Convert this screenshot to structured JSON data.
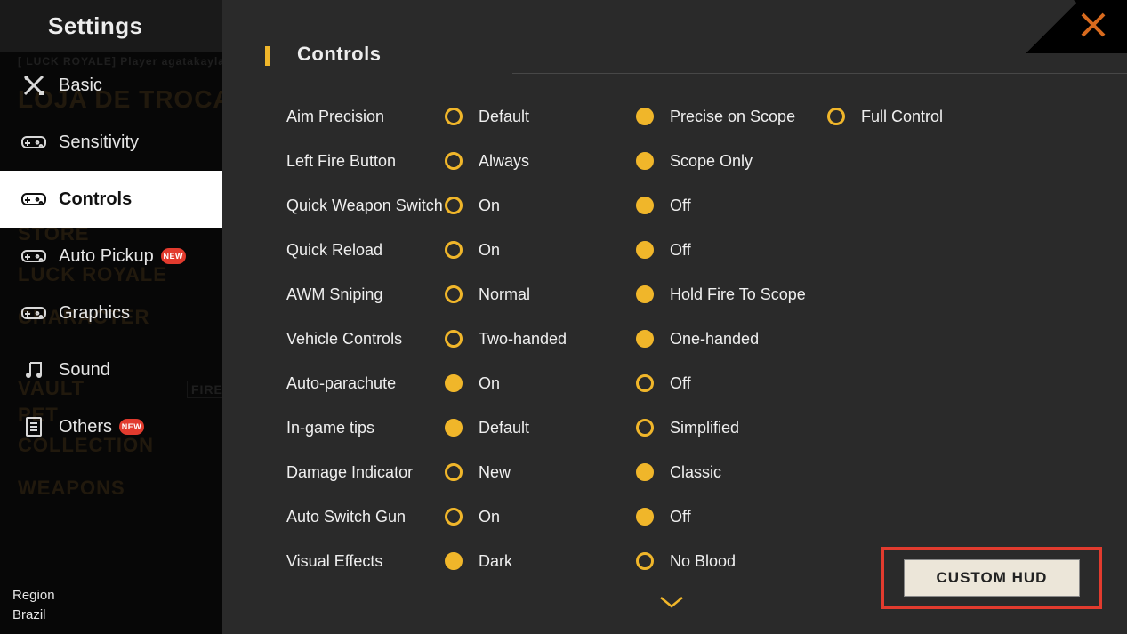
{
  "header": {
    "title": "Settings"
  },
  "bg": {
    "l0": "[ LUCK ROYALE]  Player  agatakaylane",
    "l1": "LOJA DE TROCA",
    "l2": "STORE",
    "l3": "LUCK ROYALE",
    "l4": "CHARACTER",
    "l5": "VAULT",
    "l6": "PET",
    "l7": "COLLECTION",
    "l8": "WEAPONS",
    "fire": "FIRE"
  },
  "sidebar": {
    "items": [
      {
        "label": "Basic",
        "icon": "crossed-tools-icon",
        "new": false,
        "active": false
      },
      {
        "label": "Sensitivity",
        "icon": "gamepad-icon",
        "new": false,
        "active": false
      },
      {
        "label": "Controls",
        "icon": "gamepad-icon",
        "new": false,
        "active": true
      },
      {
        "label": "Auto Pickup",
        "icon": "gamepad-icon",
        "new": true,
        "active": false
      },
      {
        "label": "Graphics",
        "icon": "gamepad-icon",
        "new": false,
        "active": false
      },
      {
        "label": "Sound",
        "icon": "music-note-icon",
        "new": false,
        "active": false
      },
      {
        "label": "Others",
        "icon": "document-icon",
        "new": true,
        "active": false
      }
    ],
    "new_badge": "NEW",
    "region_label": "Region",
    "region_value": "Brazil"
  },
  "panel": {
    "title": "Controls",
    "custom_hud": "CUSTOM HUD"
  },
  "settings": [
    {
      "label": "Aim Precision",
      "options": [
        "Default",
        "Precise on Scope",
        "Full Control"
      ],
      "selected": 1
    },
    {
      "label": "Left Fire Button",
      "options": [
        "Always",
        "Scope Only"
      ],
      "selected": 1
    },
    {
      "label": "Quick Weapon Switch",
      "options": [
        "On",
        "Off"
      ],
      "selected": 1
    },
    {
      "label": "Quick Reload",
      "options": [
        "On",
        "Off"
      ],
      "selected": 1
    },
    {
      "label": "AWM Sniping",
      "options": [
        "Normal",
        "Hold Fire To Scope"
      ],
      "selected": 1
    },
    {
      "label": "Vehicle Controls",
      "options": [
        "Two-handed",
        "One-handed"
      ],
      "selected": 1
    },
    {
      "label": "Auto-parachute",
      "options": [
        "On",
        "Off"
      ],
      "selected": 0
    },
    {
      "label": "In-game tips",
      "options": [
        "Default",
        "Simplified"
      ],
      "selected": 0
    },
    {
      "label": "Damage Indicator",
      "options": [
        "New",
        "Classic"
      ],
      "selected": 1
    },
    {
      "label": "Auto Switch Gun",
      "options": [
        "On",
        "Off"
      ],
      "selected": 1
    },
    {
      "label": "Visual Effects",
      "options": [
        "Dark",
        "No Blood"
      ],
      "selected": 0
    }
  ]
}
